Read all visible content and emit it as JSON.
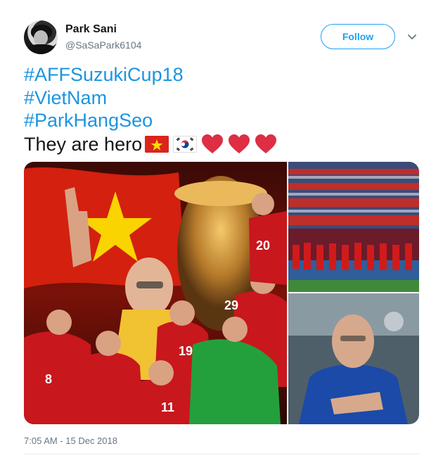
{
  "user": {
    "display_name": "Park Sani",
    "handle": "@SaSaPark6104",
    "avatar_icon": "user-avatar"
  },
  "follow_button": {
    "label": "Follow"
  },
  "menu": {
    "icon": "chevron-down-icon"
  },
  "tweet": {
    "hashtags": [
      "#AFFSuzukiCup18",
      "#VietNam",
      "#ParkHangSeo"
    ],
    "text": "They are hero",
    "emojis": [
      "vietnam-flag-icon",
      "south-korea-flag-icon",
      "red-heart-icon",
      "red-heart-icon",
      "red-heart-icon"
    ]
  },
  "media": {
    "photos": [
      "team-celebration-photo",
      "stadium-players-photo",
      "coach-portrait-photo"
    ]
  },
  "timestamp": "7:05 AM - 15 Dec 2018",
  "colors": {
    "accent": "#1da1f2",
    "hashtag": "#1b95e0",
    "secondary_text": "#657786",
    "heart": "#e0245e"
  }
}
